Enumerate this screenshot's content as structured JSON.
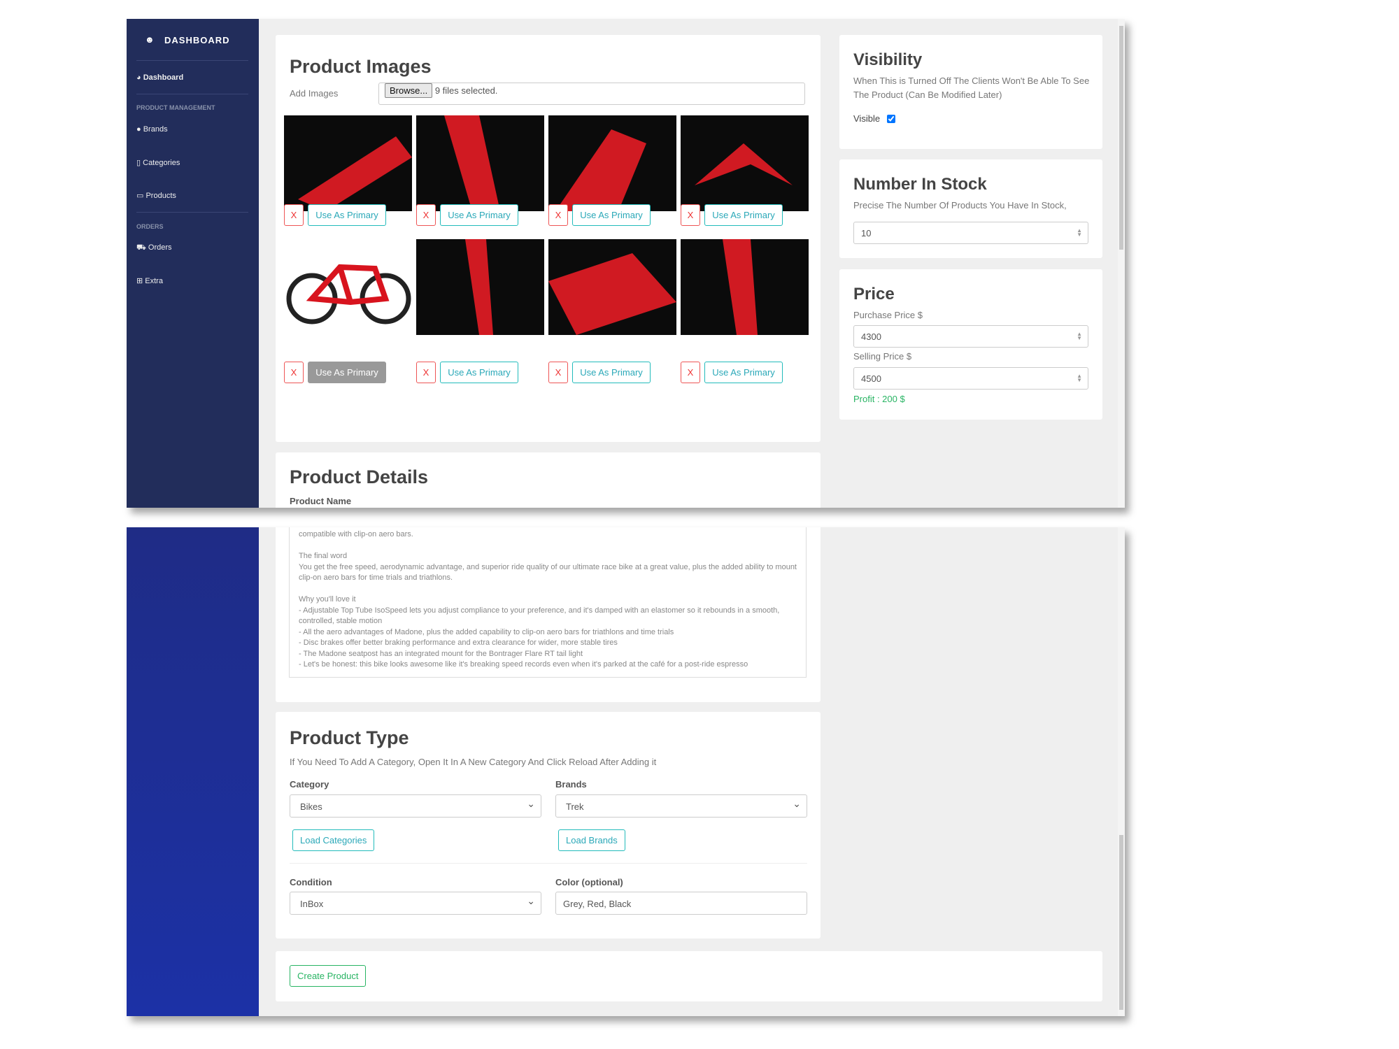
{
  "sidebar": {
    "brand": "DASHBOARD",
    "dashboard": "Dashboard",
    "section_product": "PRODUCT MANAGEMENT",
    "brands": "Brands",
    "categories": "Categories",
    "products": "Products",
    "section_orders": "ORDERS",
    "orders": "Orders",
    "extra": "Extra"
  },
  "images": {
    "title": "Product Images",
    "add_label": "Add Images",
    "browse": "Browse...",
    "files_selected": "9 files selected.",
    "remove": "X",
    "use_primary": "Use As Primary"
  },
  "visibility": {
    "title": "Visibility",
    "description": "When This is Turned Off The Clients Won't Be Able To See The Product (Can Be Modified Later)",
    "visible_label": "Visible",
    "visible": true
  },
  "stock": {
    "title": "Number In Stock",
    "description": "Precise The Number Of Products You Have In Stock,",
    "value": "10"
  },
  "price": {
    "title": "Price",
    "purchase_label": "Purchase Price $",
    "purchase_value": "4300",
    "selling_label": "Selling Price $",
    "selling_value": "4500",
    "profit": "Profit : 200 $"
  },
  "details": {
    "title": "Product Details",
    "name_label": "Product Name",
    "description": "compatible with clip-on aero bars.\n\nThe final word\nYou get the free speed, aerodynamic advantage, and superior ride quality of our ultimate race bike at a great value, plus the added ability to mount\nclip-on aero bars for time trials and triathlons.\n\nWhy you'll love it\n- Adjustable Top Tube IsoSpeed lets you adjust compliance to your preference, and it's damped with an elastomer so it rebounds in a smooth,\ncontrolled, stable motion\n- All the aero advantages of Madone, plus the added capability to clip-on aero bars for triathlons and time trials\n- Disc brakes offer better braking performance and extra clearance for wider, more stable tires\n- The Madone seatpost has an integrated mount for the Bontrager Flare RT tail light\n- Let's be honest: this bike looks awesome like it's breaking speed records even when it's parked at the café for a post-ride espresso"
  },
  "type": {
    "title": "Product Type",
    "description": "If You Need To Add A Category, Open It In A New Category And Click Reload After Adding it",
    "category_label": "Category",
    "category_value": "Bikes",
    "brands_label": "Brands",
    "brands_value": "Trek",
    "load_categories": "Load Categories",
    "load_brands": "Load Brands",
    "condition_label": "Condition",
    "condition_value": "InBox",
    "color_label": "Color (optional)",
    "color_value": "Grey, Red, Black"
  },
  "actions": {
    "create": "Create Product"
  },
  "colors": {
    "sidebar": "#222d5b",
    "accent": "#2aa8b8",
    "danger": "#e33333",
    "profit": "#28b463"
  }
}
